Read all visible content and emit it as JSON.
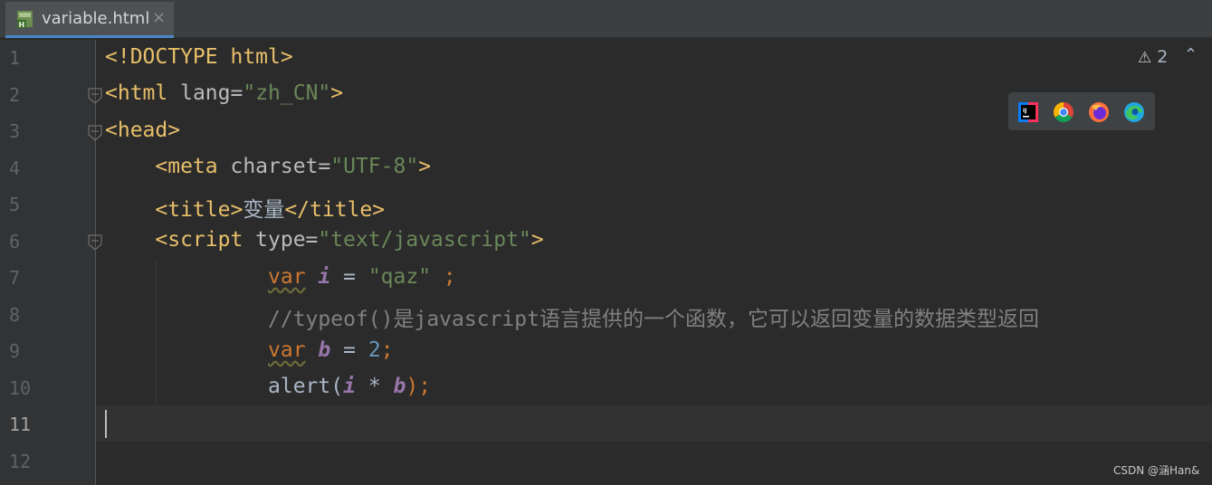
{
  "tab": {
    "filename": "variable.html",
    "close": "×"
  },
  "line_numbers": [
    "1",
    "2",
    "3",
    "4",
    "5",
    "6",
    "7",
    "8",
    "9",
    "10",
    "11",
    "12"
  ],
  "active_line": "11",
  "code": {
    "l1": "<!DOCTYPE html>",
    "l2_open": "<html ",
    "l2_attr": "lang=",
    "l2_val": "\"zh_CN\"",
    "l2_close": ">",
    "l3": "<head>",
    "l4_open": "<meta ",
    "l4_attr": "charset=",
    "l4_val": "\"UTF-8\"",
    "l4_close": ">",
    "l5_open": "<title>",
    "l5_text": "变量",
    "l5_close": "</title>",
    "l6_open": "<script ",
    "l6_attr": "type=",
    "l6_val": "\"text/javascript\"",
    "l6_close": ">",
    "l7_kw": "var",
    "l7_var": "i",
    "l7_eq": " = ",
    "l7_str": "\"qaz\"",
    "l7_semi": " ;",
    "l8_comment": "//typeof()是javascript语言提供的一个函数，它可以返回变量的数据类型返回",
    "l9_kw": "var",
    "l9_var": "b",
    "l9_eq": " = ",
    "l9_num": "2",
    "l9_semi": ";",
    "l10_fn": "alert(",
    "l10_var1": "i",
    "l10_op": " * ",
    "l10_var2": "b",
    "l10_close": ");"
  },
  "inspection": {
    "count": "2",
    "icon": "warning-icon"
  },
  "browsers": [
    "intellij-icon",
    "chrome-icon",
    "firefox-icon",
    "edge-icon"
  ],
  "watermark": "CSDN @涵Han&",
  "colors": {
    "tag": "#e8bf6a",
    "string": "#6a8759",
    "keyword": "#cc7832",
    "variable": "#9876aa",
    "number": "#6897bb",
    "comment": "#808080",
    "background": "#2b2b2b"
  }
}
